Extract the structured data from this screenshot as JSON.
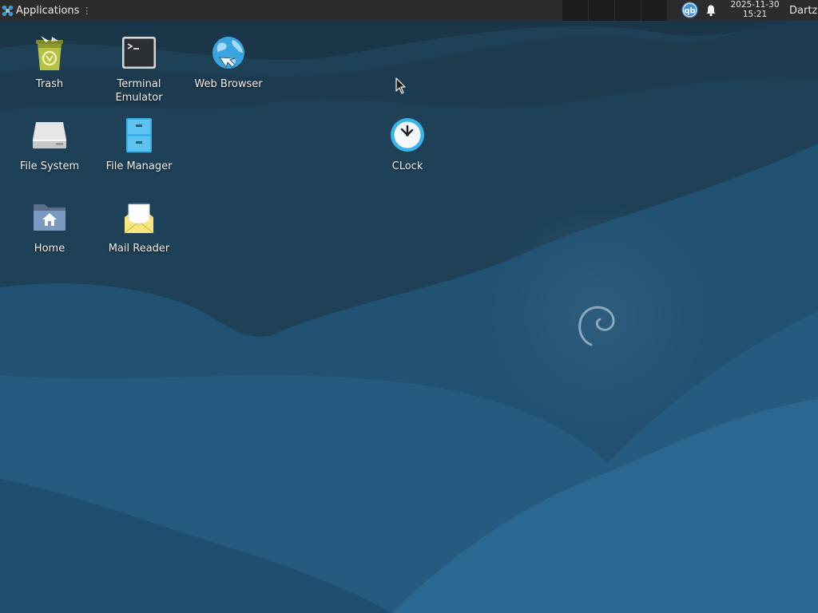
{
  "panel": {
    "applications_label": "Applications",
    "menu_handle": "⋮",
    "workspace_count": 4,
    "tray_qb_label": "qb",
    "clock_date": "2025-11-30",
    "clock_time": "15:21",
    "user_name": "Dartz"
  },
  "desktop": {
    "icons": [
      {
        "label": "Trash",
        "icon": "trash-icon"
      },
      {
        "label": "Terminal\nEmulator",
        "icon": "terminal-icon"
      },
      {
        "label": "Web Browser",
        "icon": "web-browser-icon"
      },
      {
        "label": "File System",
        "icon": "drive-icon"
      },
      {
        "label": "File Manager",
        "icon": "file-cabinet-icon"
      },
      {
        "label": "Home",
        "icon": "home-folder-icon"
      },
      {
        "label": "Mail Reader",
        "icon": "mail-icon"
      },
      {
        "label": "CLock",
        "icon": "clock-icon"
      }
    ]
  },
  "colors": {
    "panel_bg": "#2c2c2c",
    "wallpaper_dark": "#1c3c52",
    "wallpaper_light": "#2a6a92"
  }
}
